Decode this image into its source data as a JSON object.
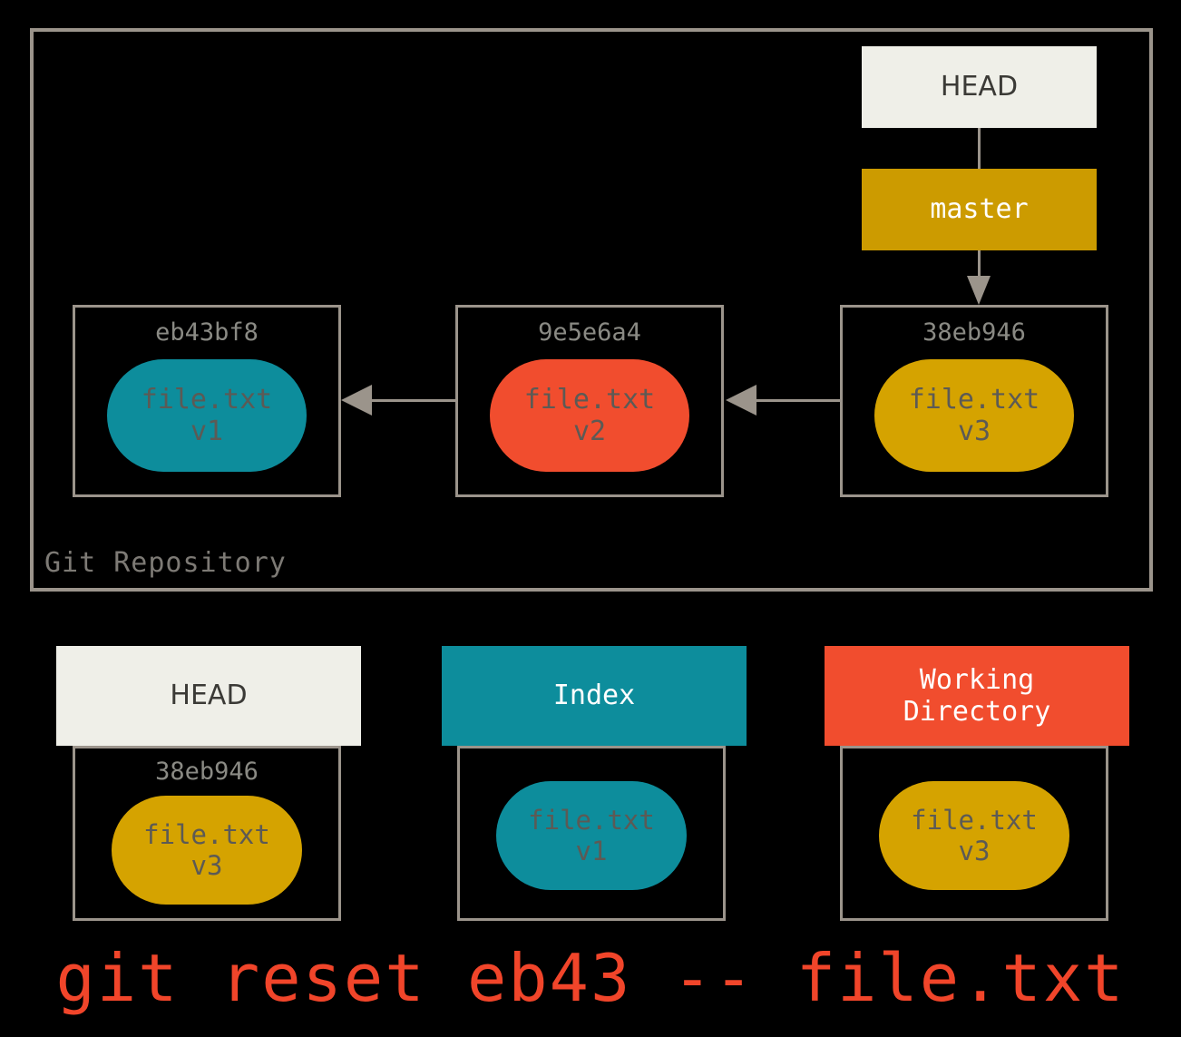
{
  "repository": {
    "label": "Git Repository",
    "head_ref": "HEAD",
    "branch_ref": "master",
    "commits": [
      {
        "hash": "eb43bf8",
        "file": "file.txt\nv1",
        "color": "teal"
      },
      {
        "hash": "9e5e6a4",
        "file": "file.txt\nv2",
        "color": "orange"
      },
      {
        "hash": "38eb946",
        "file": "file.txt\nv3",
        "color": "gold"
      }
    ]
  },
  "areas": [
    {
      "title": "HEAD",
      "hash": "38eb946",
      "file": "file.txt\nv3",
      "header_style": "light",
      "blob_color": "gold"
    },
    {
      "title": "Index",
      "hash": "",
      "file": "file.txt\nv1",
      "header_style": "teal",
      "blob_color": "teal"
    },
    {
      "title": "Working\nDirectory",
      "hash": "",
      "file": "file.txt\nv3",
      "header_style": "orange",
      "blob_color": "gold"
    }
  ],
  "command": "git reset eb43 -- file.txt",
  "colors": {
    "teal": "#0d8d9c",
    "orange": "#f14d2e",
    "gold": "#cc9b00",
    "blob_gold": "#d5a300",
    "offwhite": "#efefe8",
    "border_gray": "#9b948b",
    "text_gray": "#5c5a55",
    "command_red": "#f1452a",
    "background": "#000000"
  }
}
